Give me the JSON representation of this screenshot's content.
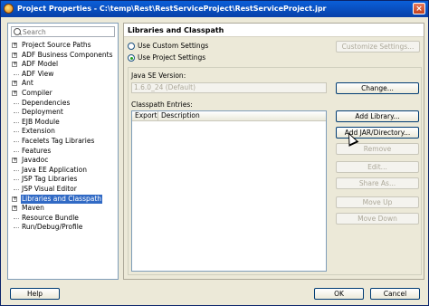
{
  "window": {
    "title": "Project Properties - C:\\temp\\Rest\\RestServiceProject\\RestServiceProject.jpr"
  },
  "search": {
    "placeholder": "Search"
  },
  "tree": [
    {
      "label": "Project Source Paths",
      "expandable": true
    },
    {
      "label": "ADF Business Components",
      "expandable": true
    },
    {
      "label": "ADF Model",
      "expandable": true
    },
    {
      "label": "ADF View",
      "expandable": false
    },
    {
      "label": "Ant",
      "expandable": true
    },
    {
      "label": "Compiler",
      "expandable": true
    },
    {
      "label": "Dependencies",
      "expandable": false
    },
    {
      "label": "Deployment",
      "expandable": false
    },
    {
      "label": "EJB Module",
      "expandable": false
    },
    {
      "label": "Extension",
      "expandable": false
    },
    {
      "label": "Facelets Tag Libraries",
      "expandable": false
    },
    {
      "label": "Features",
      "expandable": false
    },
    {
      "label": "Javadoc",
      "expandable": true
    },
    {
      "label": "Java EE Application",
      "expandable": false
    },
    {
      "label": "JSP Tag Libraries",
      "expandable": false
    },
    {
      "label": "JSP Visual Editor",
      "expandable": false
    },
    {
      "label": "Libraries and Classpath",
      "expandable": true,
      "selected": true
    },
    {
      "label": "Maven",
      "expandable": true
    },
    {
      "label": "Resource Bundle",
      "expandable": false
    },
    {
      "label": "Run/Debug/Profile",
      "expandable": false
    }
  ],
  "panel": {
    "heading": "Libraries and Classpath",
    "radio_custom": "Use Custom Settings",
    "radio_project": "Use Project Settings",
    "customize_button": "Customize Settings...",
    "java_se_label": "Java SE Version:",
    "java_se_value": "1.6.0_24 (Default)",
    "change_button": "Change...",
    "classpath_label": "Classpath Entries:",
    "col_export": "Export",
    "col_description": "Description",
    "add_library": "Add Library...",
    "add_jar": "Add JAR/Directory...",
    "remove": "Remove",
    "edit": "Edit...",
    "share_as": "Share As...",
    "move_up": "Move Up",
    "move_down": "Move Down"
  },
  "footer": {
    "help": "Help",
    "ok": "OK",
    "cancel": "Cancel"
  }
}
